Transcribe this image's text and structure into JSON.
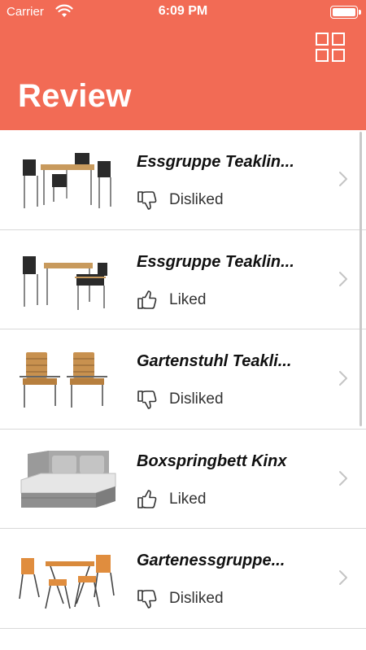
{
  "status_bar": {
    "carrier": "Carrier",
    "time": "6:09 PM"
  },
  "header": {
    "title": "Review",
    "grid_icon": "grid-icon"
  },
  "items": [
    {
      "title": "Essgruppe Teaklin...",
      "status": "Disliked",
      "icon": "thumbs-down-icon",
      "image": "dining-set-image"
    },
    {
      "title": "Essgruppe Teaklin...",
      "status": "Liked",
      "icon": "thumbs-up-icon",
      "image": "dining-set-image"
    },
    {
      "title": "Gartenstuhl Teakli...",
      "status": "Disliked",
      "icon": "thumbs-down-icon",
      "image": "garden-chairs-image"
    },
    {
      "title": "Boxspringbett Kinx",
      "status": "Liked",
      "icon": "thumbs-up-icon",
      "image": "bed-image"
    },
    {
      "title": "Gartenessgruppe...",
      "status": "Disliked",
      "icon": "thumbs-down-icon",
      "image": "bistro-set-image"
    }
  ],
  "colors": {
    "header": "#f26b55",
    "text": "#111111",
    "divider": "#d9d9d9"
  }
}
